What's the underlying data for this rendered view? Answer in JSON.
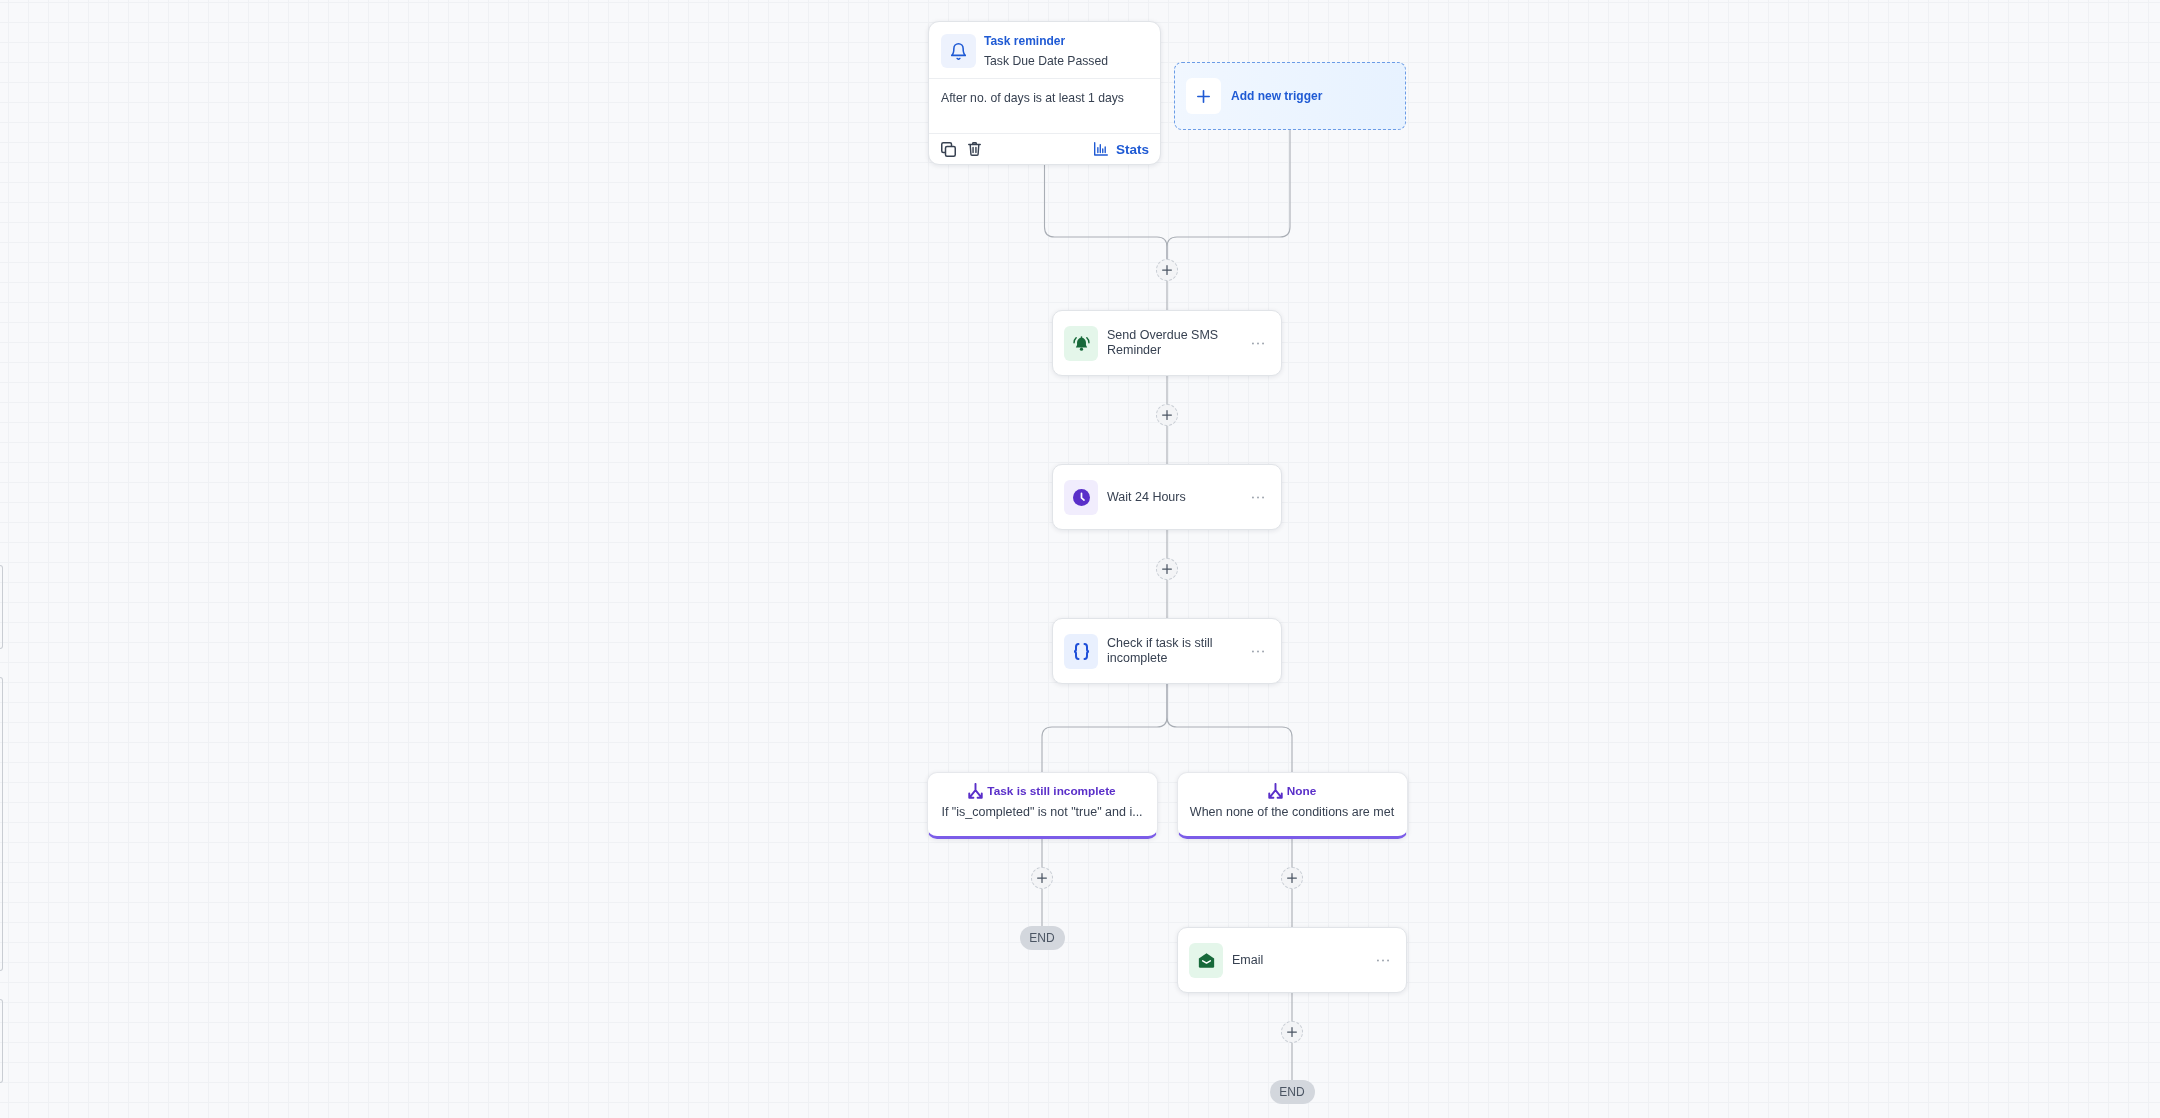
{
  "triggers": [
    {
      "title": "Task reminder",
      "event": "Task Due Date Passed",
      "condition": "After no. of days is at least 1 days",
      "stats_label": "Stats"
    }
  ],
  "add_trigger": {
    "label": "Add new trigger"
  },
  "steps": [
    {
      "kind": "sms",
      "label": "Send Overdue SMS Reminder"
    },
    {
      "kind": "wait",
      "label": "Wait 24 Hours"
    },
    {
      "kind": "condition",
      "label": "Check if task is still incomplete",
      "branches": [
        {
          "title": "Task is still incomplete",
          "description": "If \"is_completed\" is not \"true\" and i...",
          "end": "END"
        },
        {
          "title": "None",
          "description": "When none of the conditions are met",
          "steps": [
            {
              "kind": "email",
              "label": "Email"
            }
          ],
          "end": "END"
        }
      ]
    }
  ]
}
